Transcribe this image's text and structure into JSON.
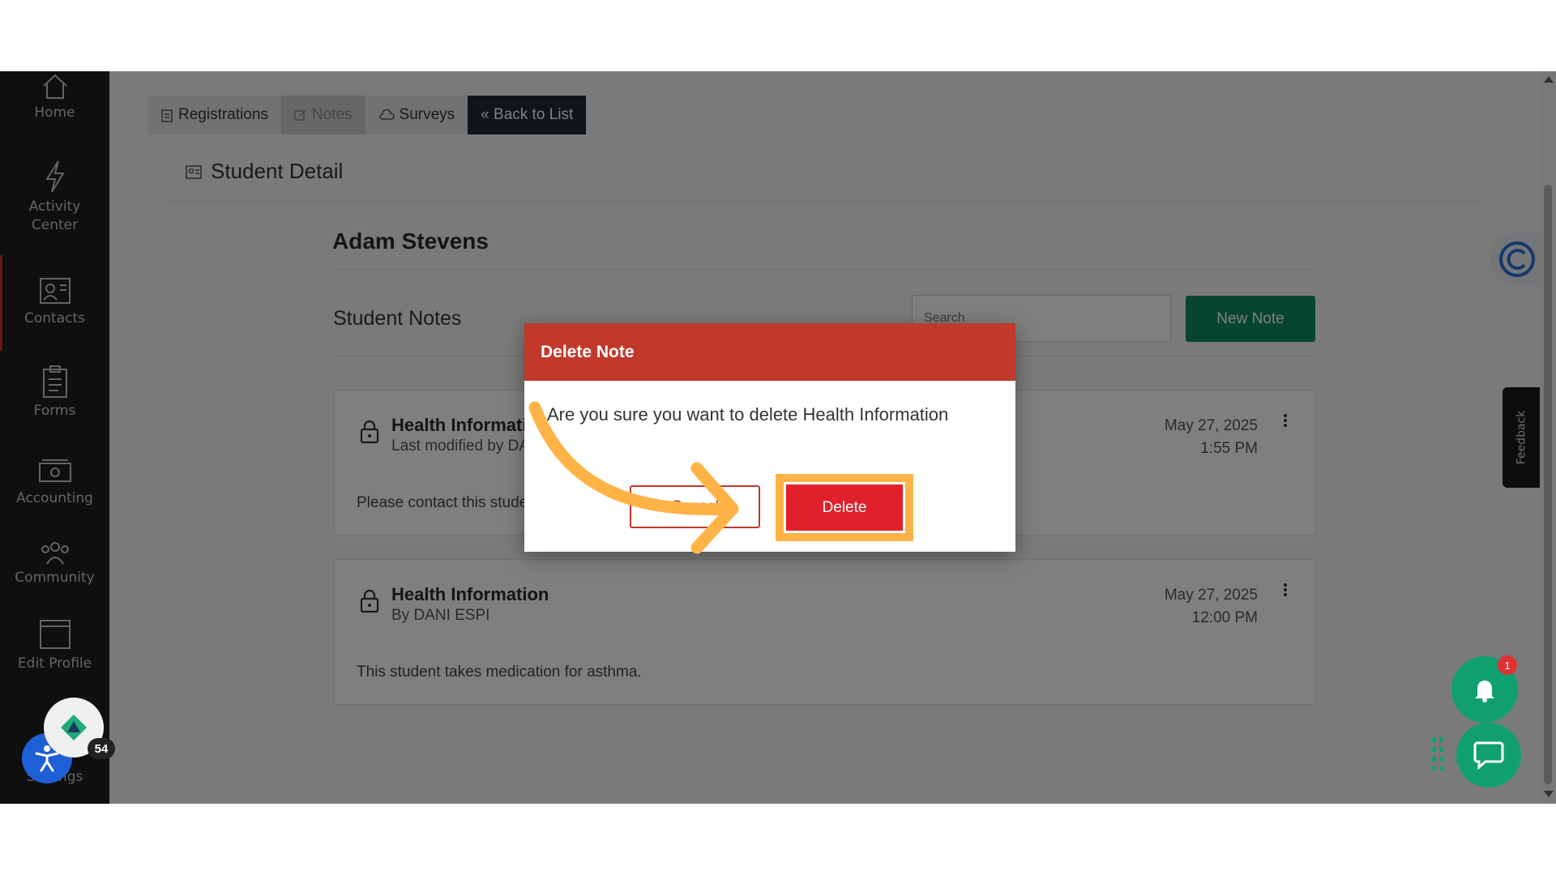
{
  "sidebar": {
    "items": [
      {
        "label": "Home",
        "icon": "home-icon"
      },
      {
        "label": "Activity Center",
        "icon": "lightning-icon"
      },
      {
        "label": "Contacts",
        "icon": "contacts-icon"
      },
      {
        "label": "Forms",
        "icon": "clipboard-icon"
      },
      {
        "label": "Accounting",
        "icon": "money-icon"
      },
      {
        "label": "Community",
        "icon": "community-icon"
      },
      {
        "label": "Edit Profile",
        "icon": "profile-icon"
      },
      {
        "label": "Settings",
        "icon": "settings-icon"
      }
    ],
    "avatar_count": "54"
  },
  "tabs": [
    {
      "label": "Registrations",
      "icon": "clipboard-icon"
    },
    {
      "label": "Notes",
      "icon": "edit-icon"
    },
    {
      "label": "Surveys",
      "icon": "cloud-icon"
    },
    {
      "label": "« Back to List"
    }
  ],
  "page_title": "Student Detail",
  "student_name": "Adam Stevens",
  "notes_section": {
    "label": "Student Notes",
    "search_placeholder": "Search",
    "new_note_label": "New Note"
  },
  "notes": [
    {
      "title": "Health Information",
      "subtitle": "Last modified by DANI ESPI",
      "date": "May 27, 2025",
      "time": "1:55 PM",
      "body": "Please contact this student's guardian for health information."
    },
    {
      "title": "Health Information",
      "subtitle": "By DANI ESPI",
      "date": "May 27, 2025",
      "time": "12:00 PM",
      "body": "This student takes medication for asthma."
    }
  ],
  "modal": {
    "title": "Delete Note",
    "message": "Are you sure you want to delete Health Information",
    "cancel_label": "Cancel",
    "delete_label": "Delete"
  },
  "feedback_label": "Feedback",
  "notification_count": "1",
  "colors": {
    "modal_header": "#c0392b",
    "delete_button": "#e0202a",
    "highlight": "#ffb347",
    "primary_green": "#0f8a5f"
  }
}
